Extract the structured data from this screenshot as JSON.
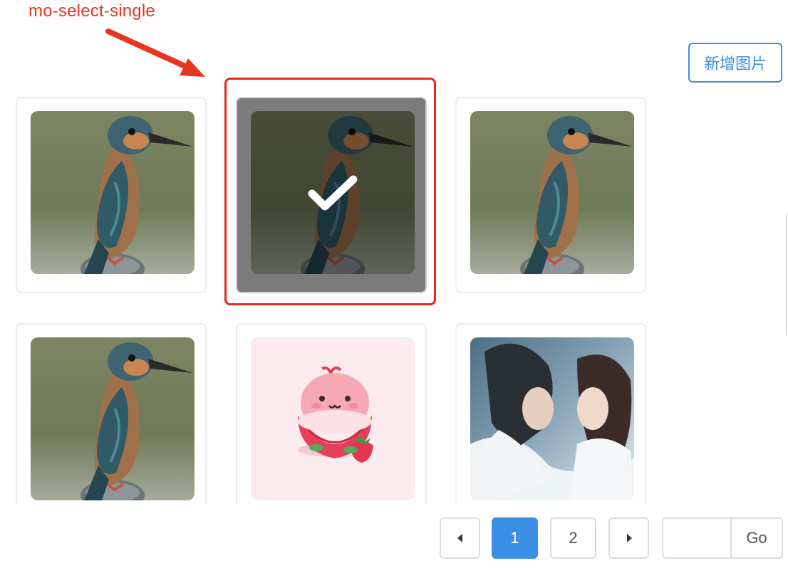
{
  "annotation": {
    "label": "mo-select-single"
  },
  "toolbar": {
    "add_label": "新增图片"
  },
  "grid": {
    "items": [
      {
        "image": "kingfisher-photo",
        "selected": false
      },
      {
        "image": "kingfisher-photo",
        "selected": true
      },
      {
        "image": "kingfisher-photo",
        "selected": false
      },
      {
        "image": "kingfisher-photo",
        "selected": false
      },
      {
        "image": "strawberry-mascot-illustration",
        "selected": false
      },
      {
        "image": "couple-drama-still",
        "selected": false
      }
    ]
  },
  "pagination": {
    "prev_icon": "caret-left-icon",
    "pages": [
      "1",
      "2"
    ],
    "current": "1",
    "next_icon": "caret-right-icon",
    "goto_placeholder": "",
    "goto_label": "Go"
  },
  "colors": {
    "accent": "#3a8ee6",
    "annotation": "#e8351f",
    "selection_frame": "#e8281c"
  }
}
